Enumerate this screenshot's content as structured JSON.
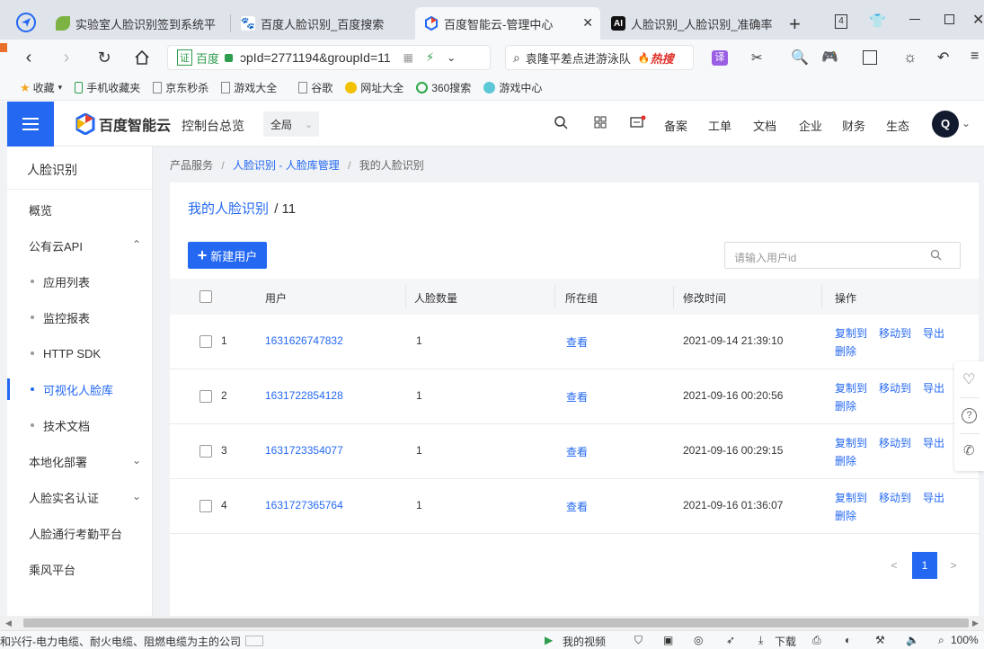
{
  "browser": {
    "tabs": [
      {
        "label": "实验室人脸识别签到系统平",
        "icon": "leaf-icon"
      },
      {
        "label": "百度人脸识别_百度搜索",
        "icon": "baidu-paw-icon"
      },
      {
        "label": "百度智能云-管理中心",
        "icon": "baidu-cloud-icon"
      },
      {
        "label": "人脸识别_人脸识别_准确率",
        "icon": "ai-icon"
      }
    ],
    "tab_counter": "4",
    "url_badge": "证",
    "url_site": "百度",
    "url_text": "ɔpId=2771194&groupId=11",
    "search_text": "袁隆平差点进游泳队",
    "search_hot": "热搜",
    "translate_label": "译",
    "bookmarks": [
      {
        "label": "收藏",
        "icon": "star-icon"
      },
      {
        "label": "手机收藏夹",
        "icon": "phone-icon"
      },
      {
        "label": "京东秒杀",
        "icon": "page-icon"
      },
      {
        "label": "游戏大全",
        "icon": "page-icon"
      },
      {
        "label": "谷歌",
        "icon": "page-icon"
      },
      {
        "label": "网址大全",
        "icon": "globe-icon"
      },
      {
        "label": "360搜索",
        "icon": "360-icon"
      },
      {
        "label": "游戏中心",
        "icon": "game-icon"
      }
    ]
  },
  "header": {
    "logo_text": "百度智能云",
    "console_label": "控制台总览",
    "region_label": "全局",
    "nav": [
      "备案",
      "工单",
      "文档",
      "企业",
      "财务",
      "生态"
    ],
    "avatar_letter": "Q"
  },
  "sidebar": {
    "title": "人脸识别",
    "items": [
      {
        "label": "概览",
        "type": "top"
      },
      {
        "label": "公有云API",
        "type": "group",
        "expanded": true
      },
      {
        "label": "应用列表",
        "type": "sub"
      },
      {
        "label": "监控报表",
        "type": "sub"
      },
      {
        "label": "HTTP SDK",
        "type": "sub"
      },
      {
        "label": "可视化人脸库",
        "type": "sub",
        "active": true
      },
      {
        "label": "技术文档",
        "type": "sub"
      },
      {
        "label": "本地化部署",
        "type": "group",
        "expanded": false
      },
      {
        "label": "人脸实名认证",
        "type": "group",
        "expanded": false
      },
      {
        "label": "人脸通行考勤平台",
        "type": "top"
      },
      {
        "label": "乘风平台",
        "type": "top"
      }
    ]
  },
  "breadcrumb": {
    "items": [
      "产品服务",
      "人脸识别 - 人脸库管理",
      "我的人脸识别"
    ],
    "sep": "/"
  },
  "page": {
    "title_link": "我的人脸识别",
    "title_suffix": "/ 11",
    "new_user_label": "新建用户",
    "search_placeholder": "请输入用户id"
  },
  "table": {
    "headers": [
      "用户",
      "人脸数量",
      "所在组",
      "修改时间",
      "操作"
    ],
    "rows": [
      {
        "index": "1",
        "user_id": "1631626747832",
        "face_count": "1",
        "group_link": "查看",
        "modified": "2021-09-14 21:39:10"
      },
      {
        "index": "2",
        "user_id": "1631722854128",
        "face_count": "1",
        "group_link": "查看",
        "modified": "2021-09-16 00:20:56"
      },
      {
        "index": "3",
        "user_id": "1631723354077",
        "face_count": "1",
        "group_link": "查看",
        "modified": "2021-09-16 00:29:15"
      },
      {
        "index": "4",
        "user_id": "1631727365764",
        "face_count": "1",
        "group_link": "查看",
        "modified": "2021-09-16 01:36:07"
      }
    ],
    "ops": {
      "copy": "复制到",
      "move": "移动到",
      "export": "导出",
      "delete": "删除"
    }
  },
  "pagination": {
    "prev": "<",
    "current": "1",
    "next": ">"
  },
  "statusbar": {
    "left_text": "和兴行-电力电缆、耐火电缆、阻燃电缆为主的公司",
    "my_video": "我的视频",
    "download": "下载",
    "zoom": "100%"
  },
  "colors": {
    "accent": "#2468f2",
    "hot": "#e0302a"
  }
}
